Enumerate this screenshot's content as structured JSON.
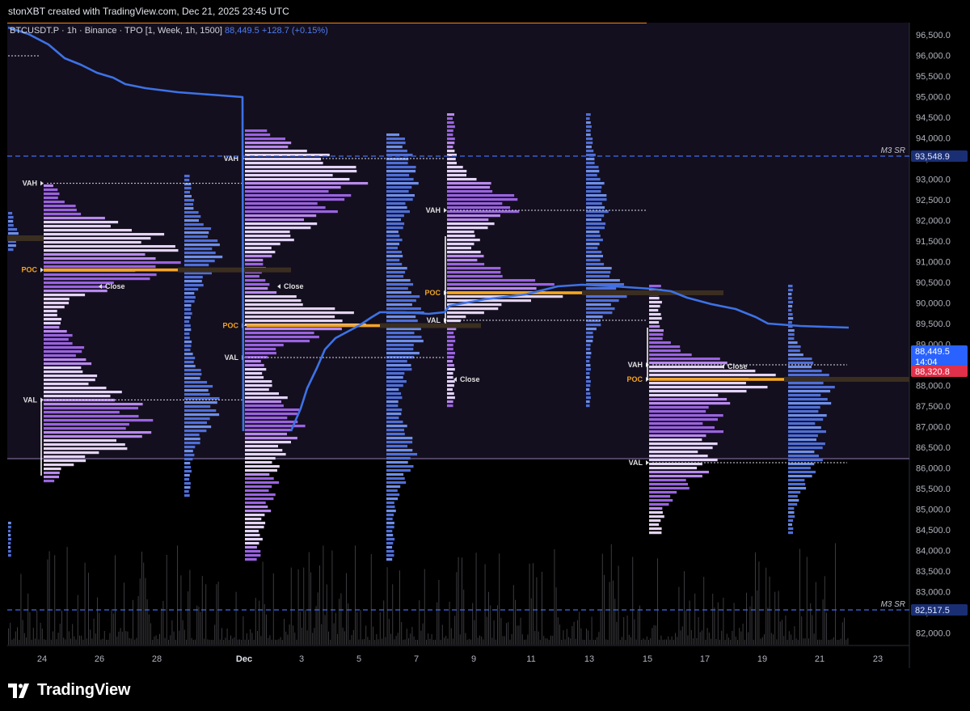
{
  "attribution": "stonXBT created with TradingView.com, Dec 21, 2025 23:45 UTC",
  "symbol": {
    "name": "BTCUSDT.P · 1h · Binance · TPO [1, Week, 1h, 1500]",
    "price": "88,449.5",
    "change": "+128.7 (+0.15%)"
  },
  "brand": "TradingView",
  "colors": {
    "bg_upper": "#140f1e",
    "bg_lower": "#000000",
    "vwap_line": "#3d72e6",
    "poc": "#f5a623",
    "sr_line": "#3d6ef0",
    "profile_purple": "#b47ef0",
    "profile_blue": "#4f6fd8",
    "last_price_badge": "#2962ff",
    "prev_close_badge": "#e0304a"
  },
  "y_axis": {
    "ticks": [
      "96,500.0",
      "96,000.0",
      "95,500.0",
      "95,000.0",
      "94,500.0",
      "94,000.0",
      "93,500.0",
      "93,000.0",
      "92,500.0",
      "92,000.0",
      "91,500.0",
      "91,000.0",
      "90,500.0",
      "90,000.0",
      "89,500.0",
      "89,000.0",
      "88,500.0",
      "88,000.0",
      "87,500.0",
      "87,000.0",
      "86,500.0",
      "86,000.0",
      "85,500.0",
      "85,000.0",
      "84,500.0",
      "84,000.0",
      "83,500.0",
      "83,000.0",
      "82,500.0",
      "82,000.0"
    ],
    "sr_upper": {
      "label": "M3 SR",
      "value": "93,548.9"
    },
    "sr_lower": {
      "label": "M3 SR",
      "value": "82,517.5"
    },
    "last_price": "88,449.5",
    "countdown": "14:04",
    "prev_close": "88,320.8"
  },
  "x_axis": {
    "ticks": [
      "24",
      "26",
      "28",
      "Dec",
      "3",
      "5",
      "7",
      "9",
      "11",
      "13",
      "15",
      "17",
      "19",
      "21",
      "23"
    ]
  },
  "profiles": {
    "labels": {
      "vah": "VAH",
      "val": "VAL",
      "poc": "POC",
      "close": "Close"
    },
    "week1": {
      "vah": 92900,
      "poc": 90800,
      "val": 87650,
      "close": 90400
    },
    "week2": {
      "vah": 93500,
      "poc": 89450,
      "val": 88550,
      "close": 90400
    },
    "week3": {
      "vah": 92250,
      "poc": 90200,
      "val": 89500,
      "close": 88150
    },
    "week4": {
      "vah": 88450,
      "poc": 88100,
      "val": 86100,
      "close": 88450
    }
  }
}
